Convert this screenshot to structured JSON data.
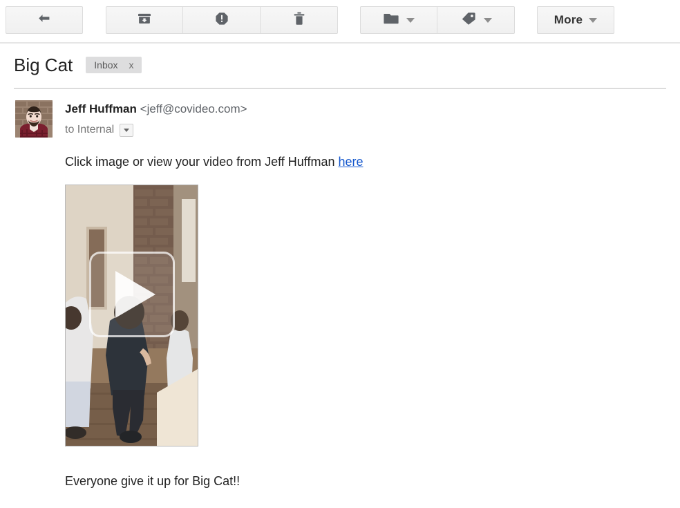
{
  "toolbar": {
    "back_button": {
      "icon": "back-arrow-icon",
      "label": ""
    },
    "archive_button": {
      "icon": "archive-icon",
      "label": ""
    },
    "spam_button": {
      "icon": "report-spam-icon",
      "label": ""
    },
    "delete_button": {
      "icon": "trash-icon",
      "label": ""
    },
    "move_to_button": {
      "icon": "folder-icon",
      "label": ""
    },
    "labels_button": {
      "icon": "label-tag-icon",
      "label": ""
    },
    "more_button": {
      "icon": "chevron-down-icon",
      "label": "More"
    }
  },
  "subject": {
    "title": "Big Cat",
    "label_chip": {
      "text": "Inbox",
      "remove": "x"
    }
  },
  "message": {
    "avatar_alt": "Jeff Huffman profile photo",
    "sender_name": "Jeff Huffman",
    "sender_email": "<jeff@covideo.com>",
    "recipient": "to Internal",
    "recipient_caret": "chevron-down-icon",
    "body_text_before": "Click image or view your video from Jeff Huffman ",
    "body_link": "here",
    "video_thumbnail": {
      "alt": "Video thumbnail of office hallway with people walking",
      "play_icon": "play-button-icon"
    },
    "closing_text": "Everyone give it up for Big Cat!!"
  },
  "colors": {
    "link": "#1155cc",
    "chip_bg": "#ddddde",
    "button_bg": "#f5f5f5",
    "icon_gray": "#5f6368",
    "text": "#222222",
    "muted_text": "#777777"
  }
}
